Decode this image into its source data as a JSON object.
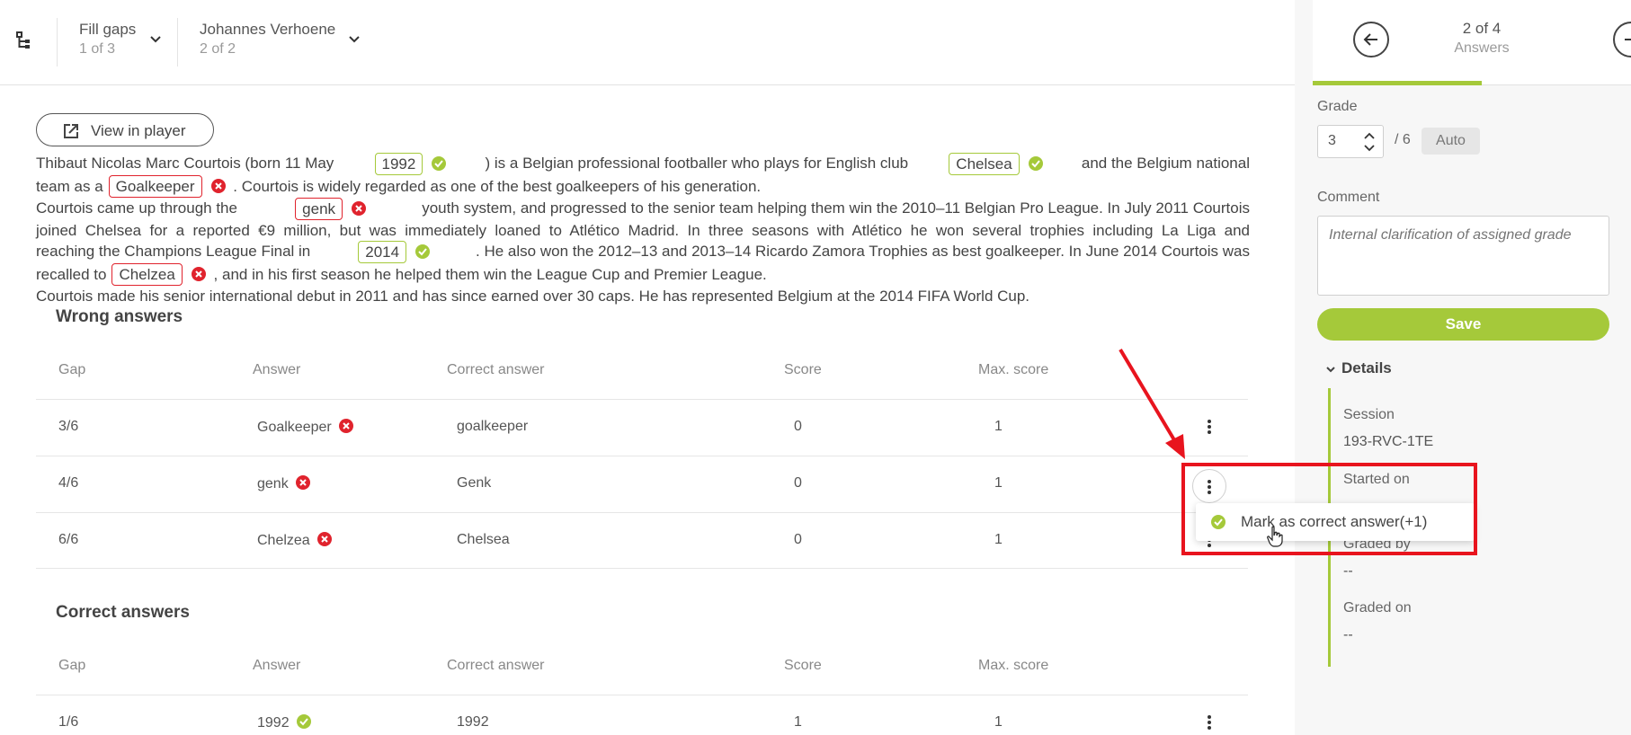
{
  "header": {
    "question": {
      "label": "Fill gaps",
      "position": "1 of 3"
    },
    "student": {
      "label": "Johannes Verhoene",
      "position": "2 of 2"
    }
  },
  "answers_nav": {
    "counter": "2 of 4",
    "label": "Answers",
    "progress": 0.5
  },
  "grade": {
    "label": "Grade",
    "value": "3",
    "max": "/ 6",
    "auto_label": "Auto"
  },
  "comment": {
    "label": "Comment",
    "placeholder": "Internal clarification of assigned grade"
  },
  "save_label": "Save",
  "details": {
    "title": "Details",
    "items": [
      {
        "label": "Session",
        "value": "193-RVC-1TE"
      },
      {
        "label": "Started on",
        "value": ""
      },
      {
        "label": "Graded by",
        "value": "--"
      },
      {
        "label": "Graded on",
        "value": "--"
      }
    ]
  },
  "view_in_player": "View in player",
  "passage": {
    "l1a": "Thibaut Nicolas Marc Courtois (born 11 May",
    "g1": "1992",
    "l1b": ") is a Belgian professional footballer who plays for English club",
    "g2": "Chelsea",
    "l1c": "and the Belgium national",
    "l2a": "team as a",
    "g3": "Goalkeeper",
    "l2b": ". Courtois is widely regarded as one of the best goalkeepers of his generation.",
    "l3a": "Courtois came up through the",
    "g4": "genk",
    "l3b": "youth system, and progressed to the senior team helping them win the 2010–11 Belgian Pro League. In July 2011 Courtois",
    "l4": "joined Chelsea for a reported €9 million, but was immediately loaned to Atlético Madrid. In three seasons with Atlético he won several trophies including La Liga and",
    "l5a": "reaching the Champions League Final in",
    "g5": "2014",
    "l5b": ". He also won the 2012–13 and 2013–14 Ricardo Zamora Trophies as best goalkeeper. In June 2014 Courtois was",
    "l6a": "recalled to",
    "g6": "Chelzea",
    "l6b": ", and in his first season he helped them win the League Cup and Premier League.",
    "l7": "Courtois made his senior international debut in 2011 and has since earned over 30 caps. He has represented Belgium at the 2014 FIFA World Cup."
  },
  "columns": {
    "gap": "Gap",
    "answer": "Answer",
    "correct": "Correct answer",
    "score": "Score",
    "max": "Max. score"
  },
  "wrong_answers": {
    "title": "Wrong answers",
    "rows": [
      {
        "gap": "3/6",
        "answer": "Goalkeeper",
        "correct": "goalkeeper",
        "score": "0",
        "max": "1"
      },
      {
        "gap": "4/6",
        "answer": "genk",
        "correct": "Genk",
        "score": "0",
        "max": "1"
      },
      {
        "gap": "6/6",
        "answer": "Chelzea",
        "correct": "Chelsea",
        "score": "0",
        "max": "1"
      }
    ]
  },
  "correct_answers": {
    "title": "Correct answers",
    "rows": [
      {
        "gap": "1/6",
        "answer": "1992",
        "correct": "1992",
        "score": "1",
        "max": "1"
      }
    ]
  },
  "context_menu": {
    "item": "Mark as correct answer(+1)"
  },
  "colors": {
    "accent": "#a5c93a",
    "error": "#e0232d",
    "annotation": "#e8141e"
  }
}
